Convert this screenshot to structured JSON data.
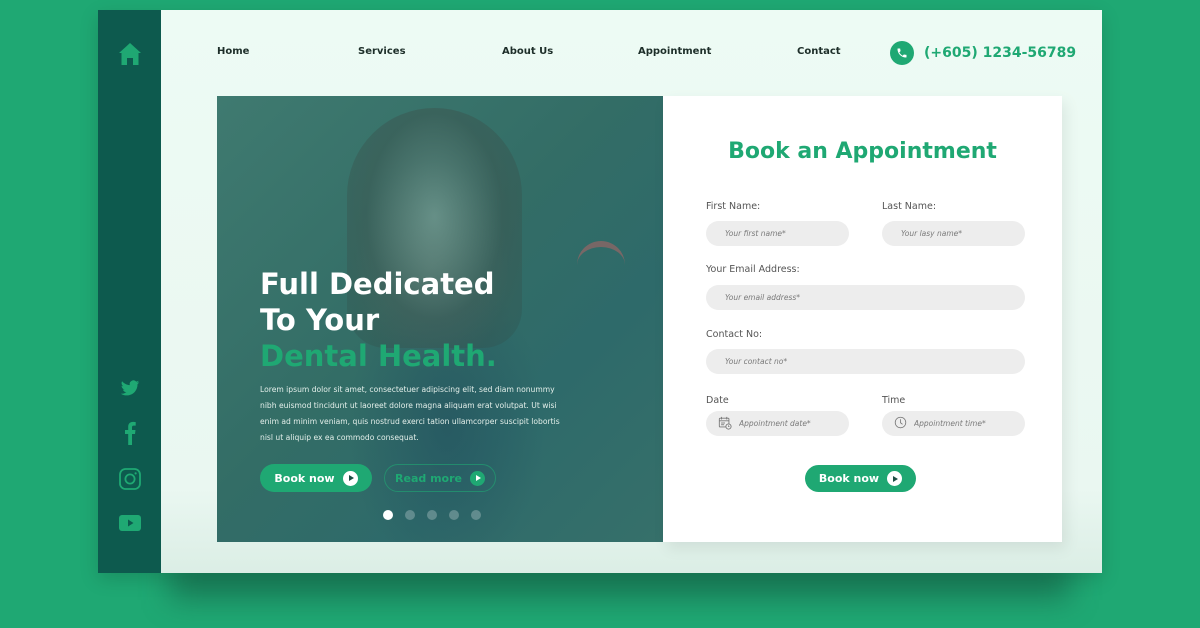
{
  "nav": {
    "items": [
      "Home",
      "Services",
      "About Us",
      "Appointment",
      "Contact"
    ],
    "phone": "(+605) 1234-56789"
  },
  "sidebar": {
    "icons": [
      "home-icon",
      "twitter-icon",
      "facebook-icon",
      "instagram-icon",
      "youtube-icon"
    ]
  },
  "hero": {
    "title_line1": "Full Dedicated",
    "title_line2": "To Your",
    "title_line3": "Dental Health.",
    "text": "Lorem ipsum dolor sit amet, consectetuer adipiscing elit, sed diam nonummy nibh euismod tincidunt ut laoreet dolore magna aliquam erat volutpat. Ut wisi enim ad minim veniam, quis nostrud exerci tation ullamcorper suscipit lobortis nisl ut aliquip ex ea commodo consequat.",
    "book_label": "Book now",
    "read_label": "Read more",
    "slides_total": 5,
    "slide_active": 1
  },
  "form": {
    "title": "Book an Appointment",
    "first_name_label": "First Name:",
    "first_name_placeholder": "Your first name*",
    "last_name_label": "Last Name:",
    "last_name_placeholder": "Your lasy name*",
    "email_label": "Your Email Address:",
    "email_placeholder": "Your email address*",
    "contact_label": "Contact No:",
    "contact_placeholder": "Your contact no*",
    "date_label": "Date",
    "date_placeholder": "Appointment date*",
    "time_label": "Time",
    "time_placeholder": "Appointment time*",
    "submit_label": "Book now"
  },
  "colors": {
    "accent": "#1fa873",
    "sidebar": "#0d5a4e",
    "background": "#1fa873"
  }
}
